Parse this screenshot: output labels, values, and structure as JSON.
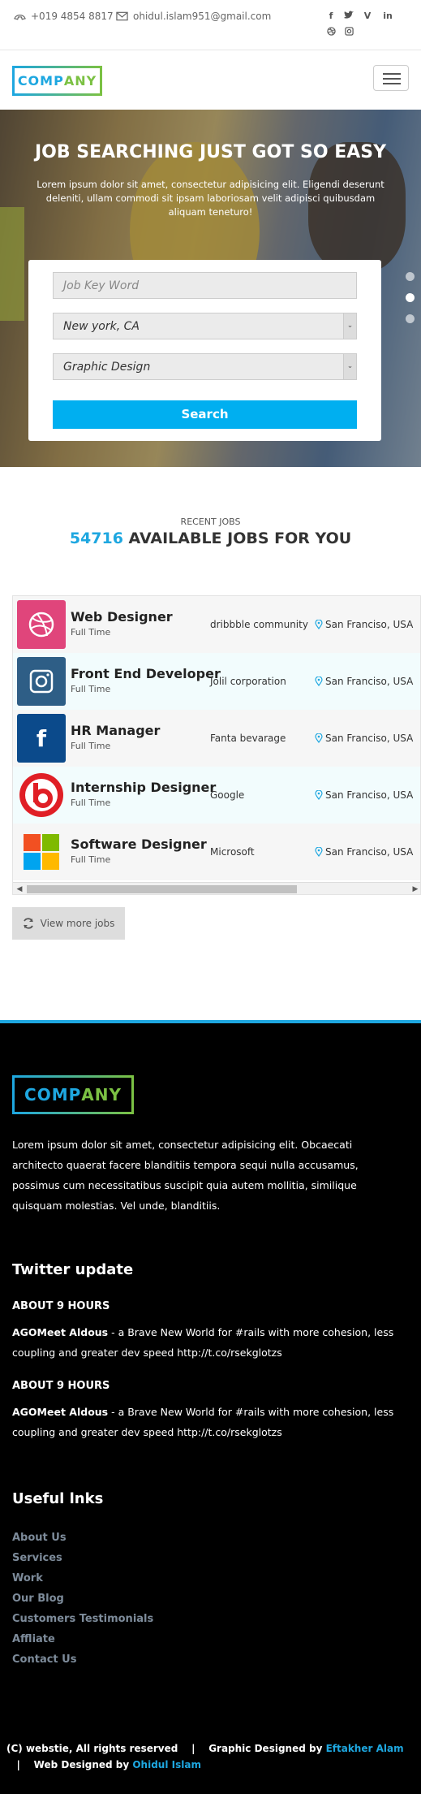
{
  "topbar": {
    "phone": "+019 4854 8817",
    "email": "ohidul.islam951@gmail.com",
    "social_icons": [
      "facebook-icon",
      "twitter-icon",
      "vine-icon",
      "linkedin-icon",
      "dribbble-icon",
      "instagram-icon"
    ]
  },
  "brand": {
    "logo_part1": "COMP",
    "logo_part2": "ANY"
  },
  "hero": {
    "title": "JOB SEARCHING JUST GOT SO EASY",
    "subtitle": "Lorem ipsum dolor sit amet, consectetur adipisicing elit. Eligendi deserunt deleniti, ullam commodi sit ipsam laboriosam velit adipisci quibusdam aliquam teneturo!",
    "keyword_placeholder": "Job Key Word",
    "location_value": "New york, CA",
    "category_value": "Graphic Design",
    "search_label": "Search"
  },
  "jobs": {
    "kicker": "RECENT JOBS",
    "count": "54716",
    "headline": "AVAILABLE JOBS FOR YOU",
    "rows": [
      {
        "title": "Web Designer",
        "type": "Full Time",
        "company": "dribbble community",
        "location": "San Franciso, USA",
        "icon": "dribbble-icon",
        "color": "#e0457b"
      },
      {
        "title": "Front End Developer",
        "type": "Full Time",
        "company": "Jolil corporation",
        "location": "San Franciso, USA",
        "icon": "instagram-icon",
        "color": "#2e5e86"
      },
      {
        "title": "HR Manager",
        "type": "Full Time",
        "company": "Fanta bevarage",
        "location": "San Franciso, USA",
        "icon": "facebook-icon",
        "color": "#0b4a8b"
      },
      {
        "title": "Internship Designer",
        "type": "Full Time",
        "company": "Google",
        "location": "San Franciso, USA",
        "icon": "beats-icon",
        "color": "#e01f26"
      },
      {
        "title": "Software Designer",
        "type": "Full Time",
        "company": "Microsoft",
        "location": "San Franciso, USA",
        "icon": "microsoft-icon",
        "color": "#f25022"
      }
    ],
    "more_label": "View more jobs"
  },
  "footer": {
    "description": "Lorem ipsum dolor sit amet, consectetur adipisicing elit. Obcaecati architecto quaerat facere blanditiis tempora sequi nulla accusamus, possimus cum necessitatibus suscipit quia autem mollitia, similique quisquam molestias. Vel unde, blanditiis.",
    "twitter_heading": "Twitter update",
    "tweets": [
      {
        "time": "ABOUT 9 HOURS",
        "author": "AGOMeet Aldous",
        "text": " - a Brave New World for #rails with more cohesion, less coupling and greater dev speed http://t.co/rsekglotzs"
      },
      {
        "time": "ABOUT 9 HOURS",
        "author": "AGOMeet Aldous",
        "text": " - a Brave New World for #rails with more cohesion, less coupling and greater dev speed http://t.co/rsekglotzs"
      }
    ],
    "links_heading": "Useful lnks",
    "links": [
      "About Us",
      "Services",
      "Work",
      "Our Blog",
      "Customers Testimonials",
      "Affliate",
      "Contact Us"
    ],
    "copyright": "(C) webstie, All rights reserved",
    "sep": "|",
    "graphic_prefix": "Graphic Designed by ",
    "graphic_author": "Eftakher Alam",
    "web_prefix": "Web Designed by ",
    "web_author": "Ohidul Islam"
  }
}
